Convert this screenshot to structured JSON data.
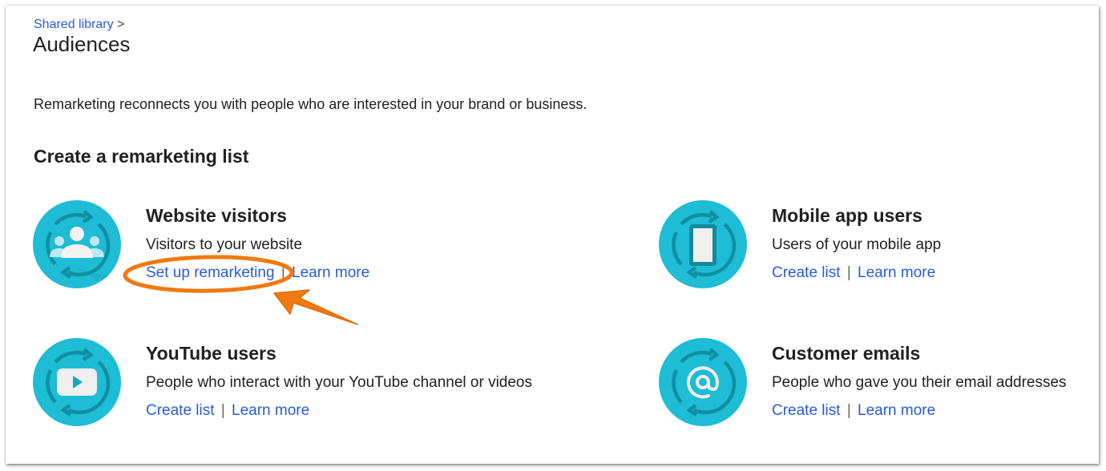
{
  "breadcrumb": {
    "parent": "Shared library",
    "separator": ">"
  },
  "page": {
    "title": "Audiences",
    "intro": "Remarketing reconnects you with people who are interested in your brand or business.",
    "section_title": "Create a remarketing list"
  },
  "tiles": [
    {
      "name": "Website visitors",
      "description": "Visitors to your website",
      "icon": "people-group-icon",
      "primary_link": "Set up remarketing",
      "secondary_link": "Learn more",
      "separator": "|"
    },
    {
      "name": "Mobile app users",
      "description": "Users of your mobile app",
      "icon": "mobile-phone-icon",
      "primary_link": "Create list",
      "secondary_link": "Learn more",
      "separator": "|"
    },
    {
      "name": "YouTube users",
      "description": "People who interact with your YouTube channel or videos",
      "icon": "youtube-play-icon",
      "primary_link": "Create list",
      "secondary_link": "Learn more",
      "separator": "|"
    },
    {
      "name": "Customer emails",
      "description": "People who gave you their email addresses",
      "icon": "at-sign-icon",
      "primary_link": "Create list",
      "secondary_link": "Learn more",
      "separator": "|"
    }
  ],
  "colors": {
    "icon_circle": "#1ebcd5",
    "icon_ring": "#0e8a9c",
    "link": "#2a5bd7",
    "annotation": "#f07a10"
  }
}
